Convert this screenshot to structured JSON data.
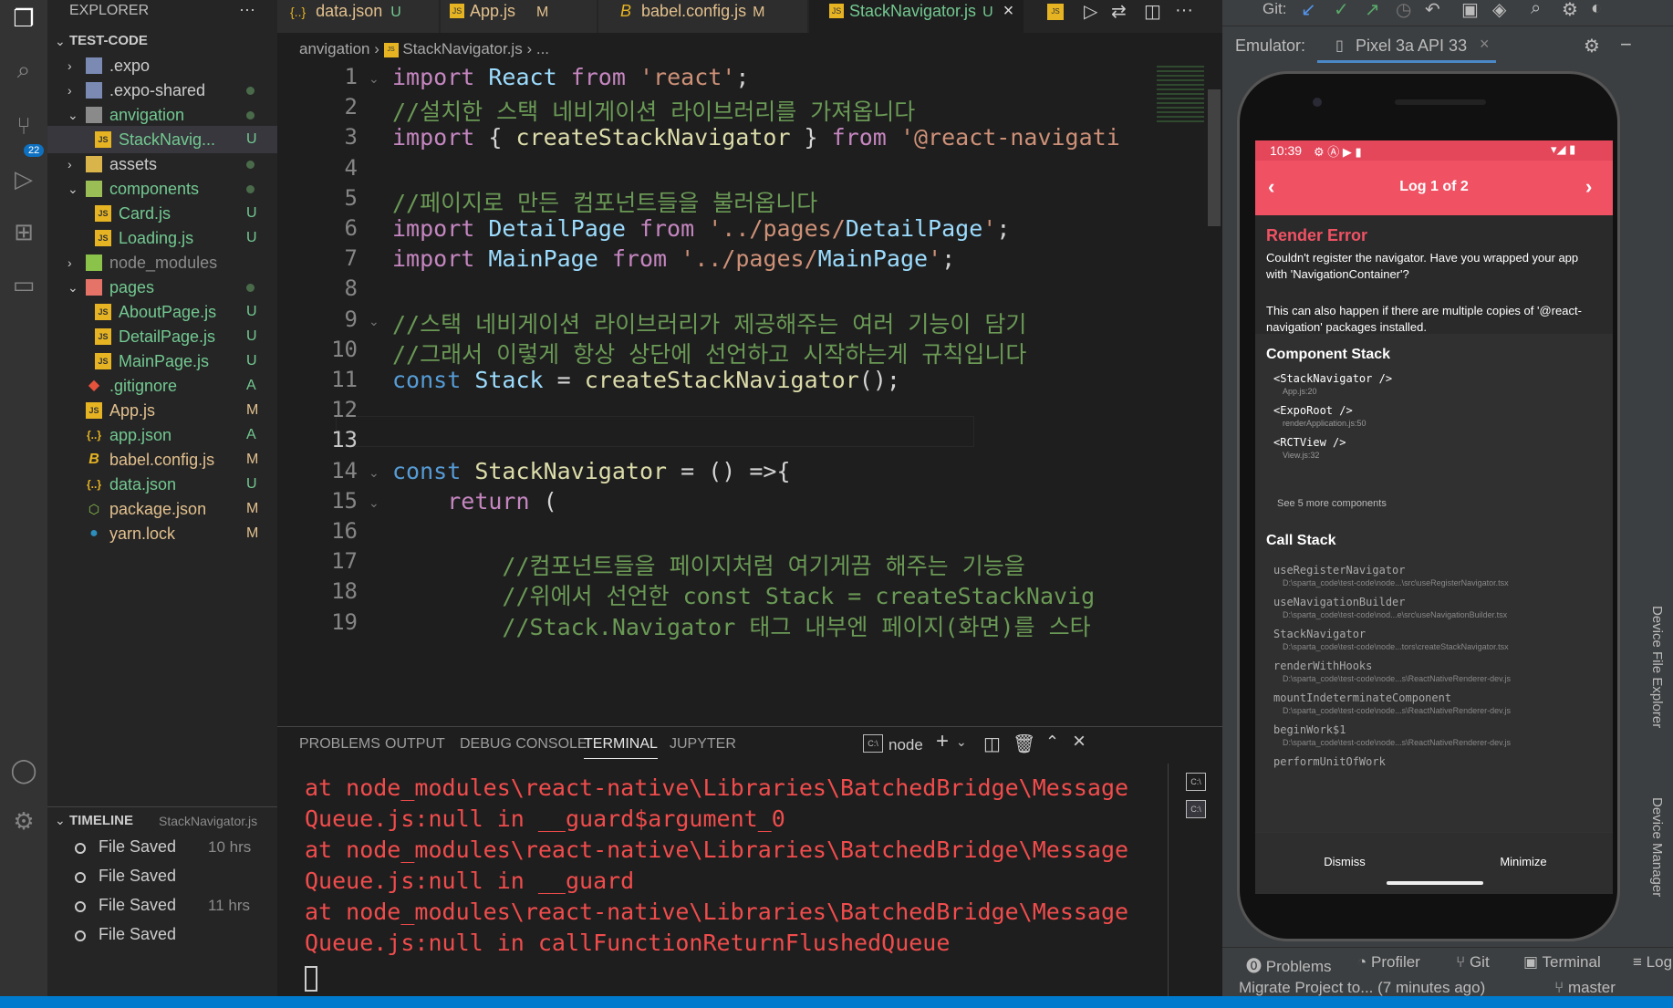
{
  "explorer": {
    "title": "EXPLORER",
    "more": "···",
    "project": "TEST-CODE",
    "items": [
      {
        "label": ".expo",
        "status": ""
      },
      {
        "label": ".expo-shared",
        "status": ""
      },
      {
        "label": "anvigation",
        "status": ""
      },
      {
        "label": "StackNavig...",
        "status": "U"
      },
      {
        "label": "assets",
        "status": ""
      },
      {
        "label": "components",
        "status": ""
      },
      {
        "label": "Card.js",
        "status": "U"
      },
      {
        "label": "Loading.js",
        "status": "U"
      },
      {
        "label": "node_modules",
        "status": ""
      },
      {
        "label": "pages",
        "status": ""
      },
      {
        "label": "AboutPage.js",
        "status": "U"
      },
      {
        "label": "DetailPage.js",
        "status": "U"
      },
      {
        "label": "MainPage.js",
        "status": "U"
      },
      {
        "label": ".gitignore",
        "status": "A"
      },
      {
        "label": "App.js",
        "status": "M"
      },
      {
        "label": "app.json",
        "status": "A"
      },
      {
        "label": "babel.config.js",
        "status": "M"
      },
      {
        "label": "data.json",
        "status": "U"
      },
      {
        "label": "package.json",
        "status": "M"
      },
      {
        "label": "yarn.lock",
        "status": "M"
      }
    ],
    "badge": "22"
  },
  "timeline": {
    "title": "TIMELINE",
    "file": "StackNavigator.js",
    "entries": [
      {
        "label": "File Saved",
        "time": "10 hrs"
      },
      {
        "label": "File Saved",
        "time": ""
      },
      {
        "label": "File Saved",
        "time": "11 hrs"
      },
      {
        "label": "File Saved",
        "time": ""
      }
    ]
  },
  "tabs": [
    {
      "label": "data.json",
      "status": "U",
      "icon": "{..}"
    },
    {
      "label": "App.js",
      "status": "M",
      "icon": "JS"
    },
    {
      "label": "babel.config.js",
      "status": "M",
      "icon": "B"
    },
    {
      "label": "StackNavigator.js",
      "status": "U",
      "icon": "JS"
    }
  ],
  "breadcrumb": {
    "folder": "anvigation",
    "file": "StackNavigator.js",
    "tail": "..."
  },
  "editor": {
    "lines": [
      {
        "n": "1",
        "t": "import React from 'react';"
      },
      {
        "n": "2",
        "t": "//설치한 스택 네비게이션 라이브러리를 가져옵니다"
      },
      {
        "n": "3",
        "t": "import { createStackNavigator } from '@react-navigati"
      },
      {
        "n": "4",
        "t": ""
      },
      {
        "n": "5",
        "t": "//페이지로 만든 컴포넌트들을 불러옵니다"
      },
      {
        "n": "6",
        "t": "import DetailPage from '../pages/DetailPage';"
      },
      {
        "n": "7",
        "t": "import MainPage from '../pages/MainPage';"
      },
      {
        "n": "8",
        "t": ""
      },
      {
        "n": "9",
        "t": "//스택 네비게이션 라이브러리가 제공해주는 여러 기능이 담기"
      },
      {
        "n": "10",
        "t": "//그래서 이렇게 항상 상단에 선언하고 시작하는게 규칙입니다"
      },
      {
        "n": "11",
        "t": "const Stack = createStackNavigator();"
      },
      {
        "n": "12",
        "t": ""
      },
      {
        "n": "13",
        "t": ""
      },
      {
        "n": "14",
        "t": "const StackNavigator = () =>{"
      },
      {
        "n": "15",
        "t": "    return ("
      },
      {
        "n": "16",
        "t": ""
      },
      {
        "n": "17",
        "t": "        //컴포넌트들을 페이지처럼 여기게끔 해주는 기능을"
      },
      {
        "n": "18",
        "t": "        //위에서 선언한 const Stack = createStackNavig"
      },
      {
        "n": "19",
        "t": "        //Stack.Navigator 태그 내부엔 페이지(화면)를 스타"
      }
    ]
  },
  "panel": {
    "tabs": [
      "PROBLEMS",
      "OUTPUT",
      "DEBUG CONSOLE",
      "TERMINAL",
      "JUPYTER"
    ],
    "shell": "node",
    "terminal": [
      "at node_modules\\react-native\\Libraries\\BatchedBridge\\Message",
      "Queue.js:null in __guard$argument_0",
      "at node_modules\\react-native\\Libraries\\BatchedBridge\\Message",
      "Queue.js:null in __guard",
      "at node_modules\\react-native\\Libraries\\BatchedBridge\\Message",
      "Queue.js:null in callFunctionReturnFlushedQueue"
    ]
  },
  "studio": {
    "git_label": "Git:",
    "emulator_label": "Emulator:",
    "device": "Pixel 3a API 33",
    "phone": {
      "time": "10:39",
      "log_title": "Log 1 of 2",
      "error_title": "Render Error",
      "error_msg": "Couldn't register the navigator. Have you wrapped your app with 'NavigationContainer'?",
      "error_msg2": "This can also happen if there are multiple copies of '@react-navigation' packages installed.",
      "component_stack_title": "Component Stack",
      "components": [
        {
          "name": "<StackNavigator />",
          "loc": "App.js:20"
        },
        {
          "name": "<ExpoRoot />",
          "loc": "renderApplication.js:50"
        },
        {
          "name": "<RCTView />",
          "loc": "View.js:32"
        }
      ],
      "see_more": "See 5 more components",
      "call_stack_title": "Call Stack",
      "calls": [
        {
          "name": "useRegisterNavigator",
          "loc": "D:\\sparta_code\\test-code\\node...\\src\\useRegisterNavigator.tsx"
        },
        {
          "name": "useNavigationBuilder",
          "loc": "D:\\sparta_code\\test-code\\nod...e\\src\\useNavigationBuilder.tsx"
        },
        {
          "name": "StackNavigator",
          "loc": "D:\\sparta_code\\test-code\\node...tors\\createStackNavigator.tsx"
        },
        {
          "name": "renderWithHooks",
          "loc": "D:\\sparta_code\\test-code\\node...s\\ReactNativeRenderer-dev.js"
        },
        {
          "name": "mountIndeterminateComponent",
          "loc": "D:\\sparta_code\\test-code\\node...s\\ReactNativeRenderer-dev.js"
        },
        {
          "name": "beginWork$1",
          "loc": "D:\\sparta_code\\test-code\\node...s\\ReactNativeRenderer-dev.js"
        },
        {
          "name": "performUnitOfWork",
          "loc": ""
        }
      ],
      "dismiss": "Dismiss",
      "minimize": "Minimize"
    },
    "bottom_tabs": [
      "Problems",
      "Profiler",
      "Git",
      "Terminal",
      "Log"
    ],
    "status_msg": "Migrate Project to... (7 minutes ago)",
    "branch": "master",
    "side_labels": [
      "Device File Explorer",
      "Device Manager"
    ]
  },
  "colors": {
    "accent": "#007acc",
    "error_red": "#f05264",
    "terminal_red": "#f14c4c"
  }
}
